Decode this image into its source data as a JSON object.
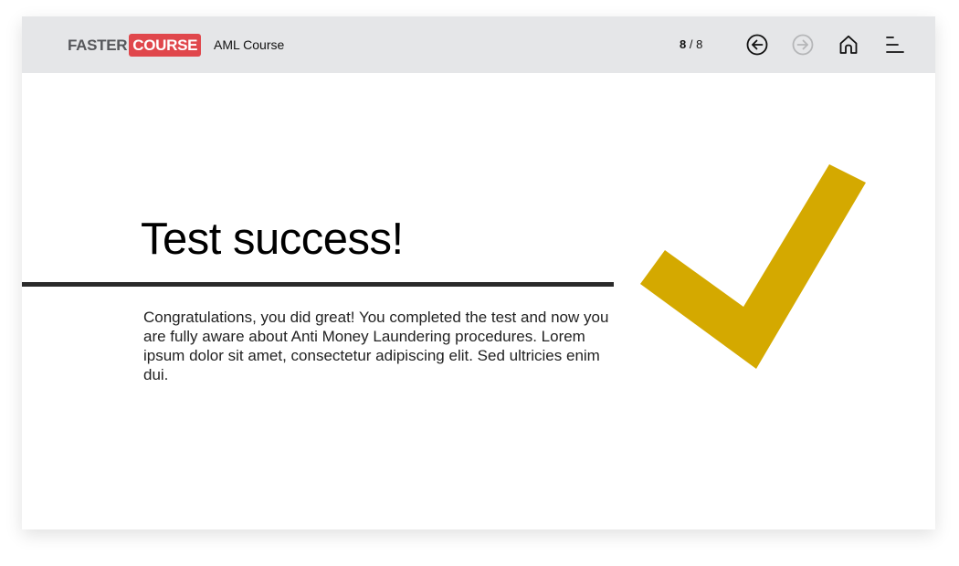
{
  "header": {
    "logo_part1": "FASTER",
    "logo_part2": "COURSE",
    "course_title": "AML Course",
    "page_current": "8",
    "page_separator": " / ",
    "page_total": "8"
  },
  "nav": {
    "prev_icon": "arrow-left-circle-icon",
    "next_icon": "arrow-right-circle-icon",
    "next_enabled": false,
    "home_icon": "home-icon",
    "menu_icon": "menu-icon"
  },
  "main": {
    "heading": "Test success!",
    "body": "Congratulations, you did great! You completed the test and now you are fully aware about Anti Money Laundering procedures. Lorem ipsum dolor sit amet, consectetur adipiscing elit. Sed ultricies enim dui.",
    "illustration_icon": "checkmark-icon"
  },
  "colors": {
    "topbar_bg": "#e5e6e8",
    "logo_accent": "#e0474c",
    "checkmark": "#d4a900",
    "divider": "#2a2a2a",
    "disabled_icon": "#b5b6b8"
  }
}
